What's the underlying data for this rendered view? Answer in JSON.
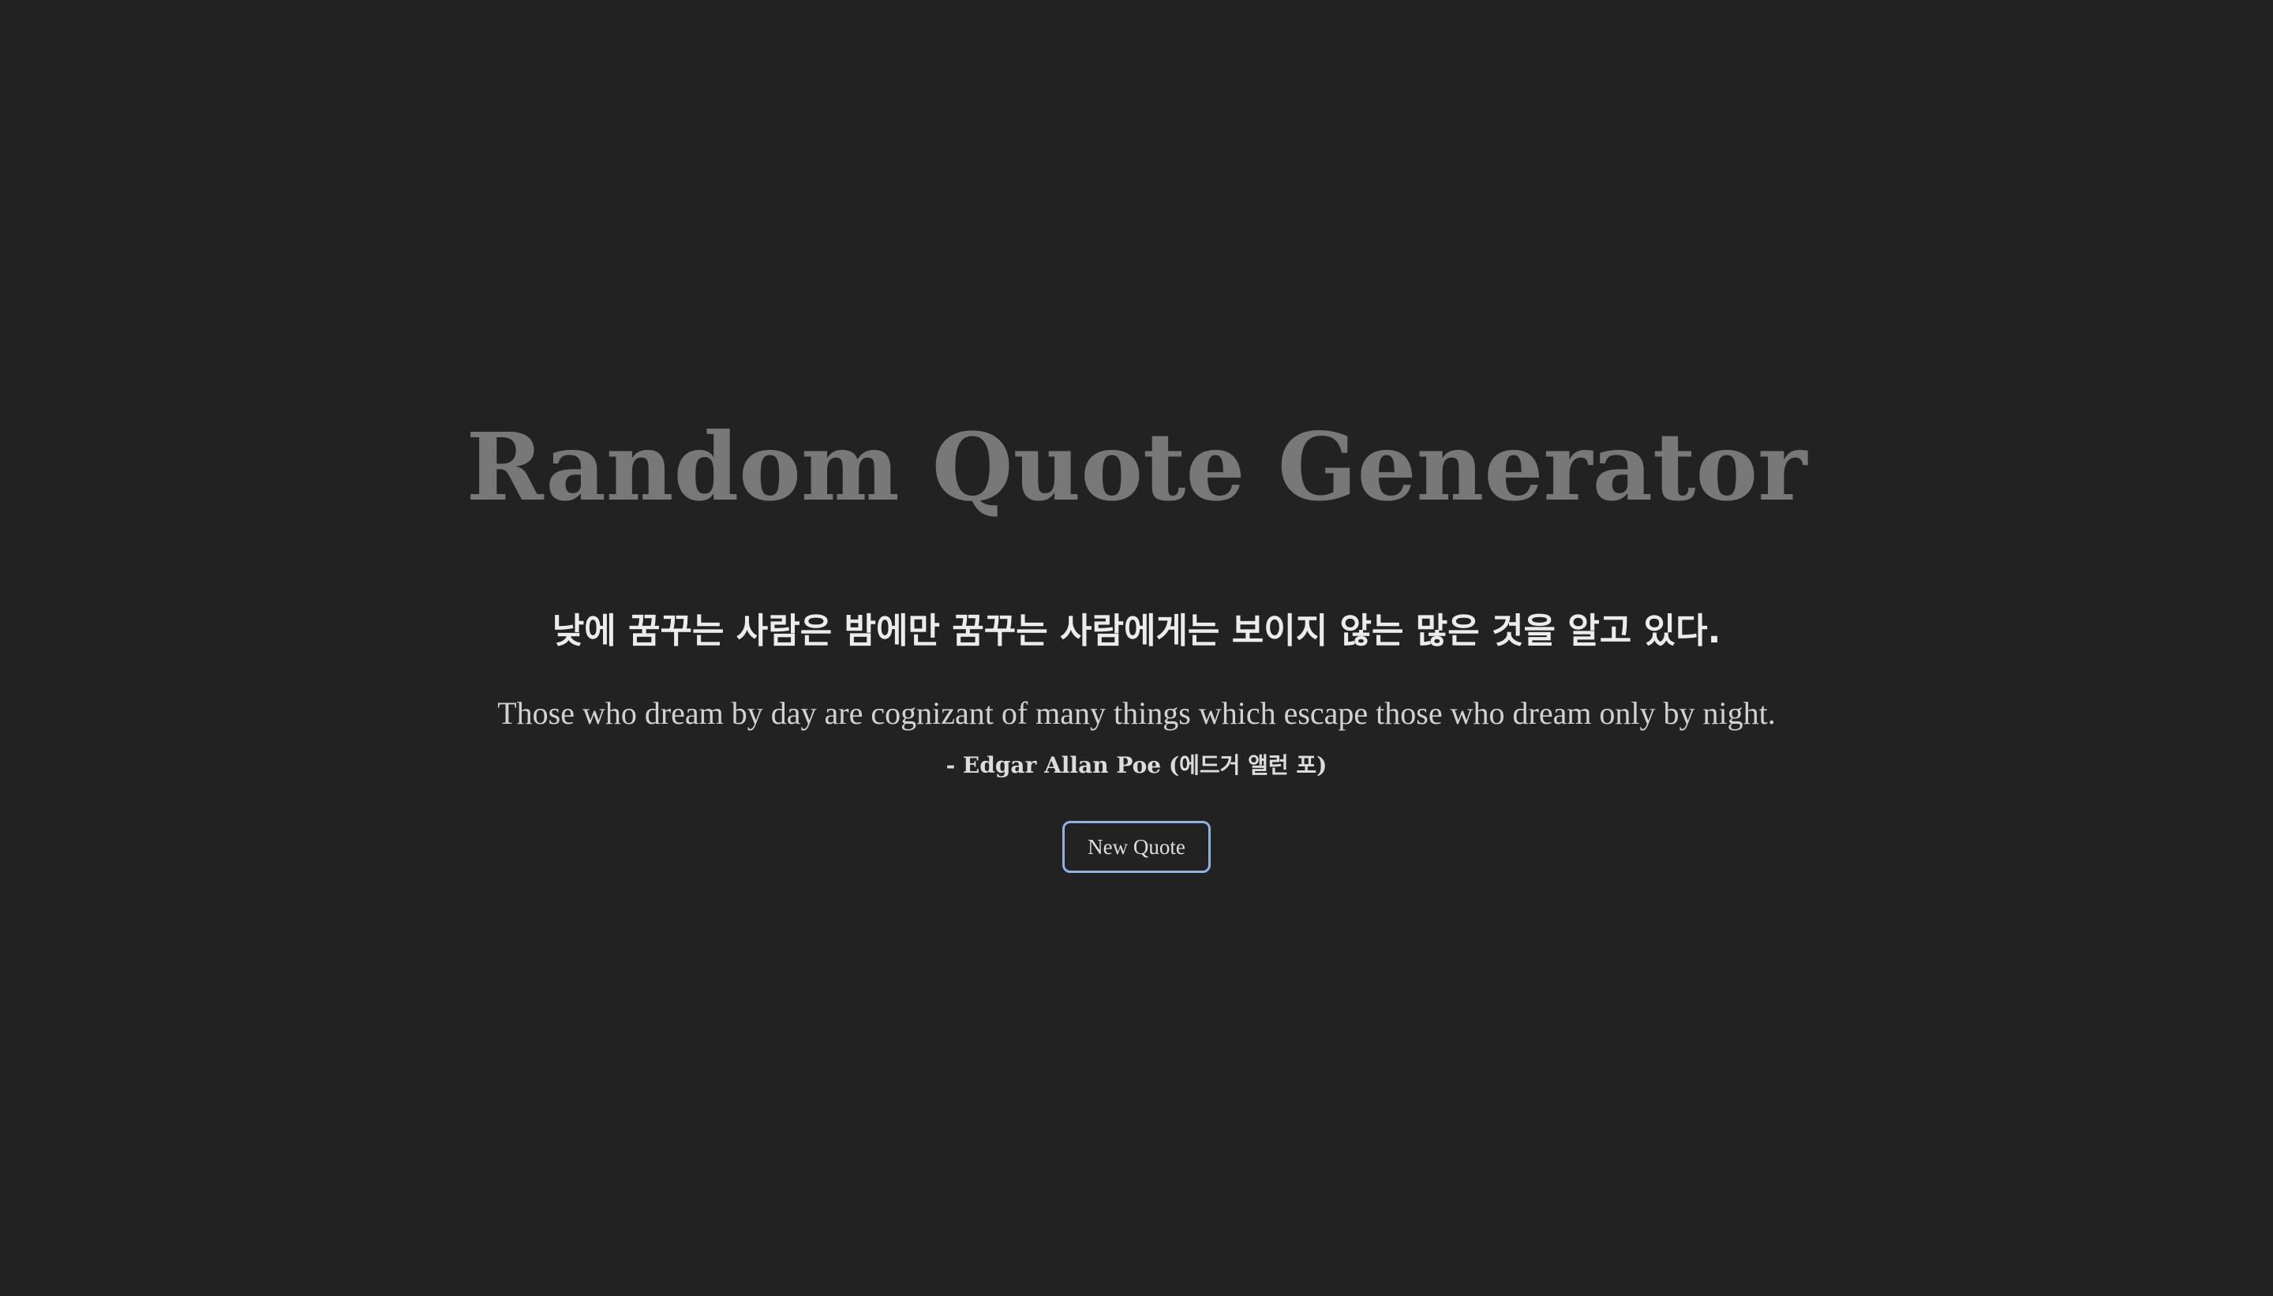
{
  "app": {
    "title": "Random Quote Generator"
  },
  "quote": {
    "korean": "낮에 꿈꾸는 사람은 밤에만 꿈꾸는 사람에게는 보이지 않는 많은 것을 알고 있다.",
    "english": "Those who dream by day are cognizant of many things which escape those who dream only by night.",
    "author": "- Edgar Allan Poe (에드거 앨런 포)"
  },
  "actions": {
    "new_quote_label": "New Quote"
  },
  "colors": {
    "background": "#222222",
    "title": "#787878",
    "button_border": "#8fb4e0"
  }
}
